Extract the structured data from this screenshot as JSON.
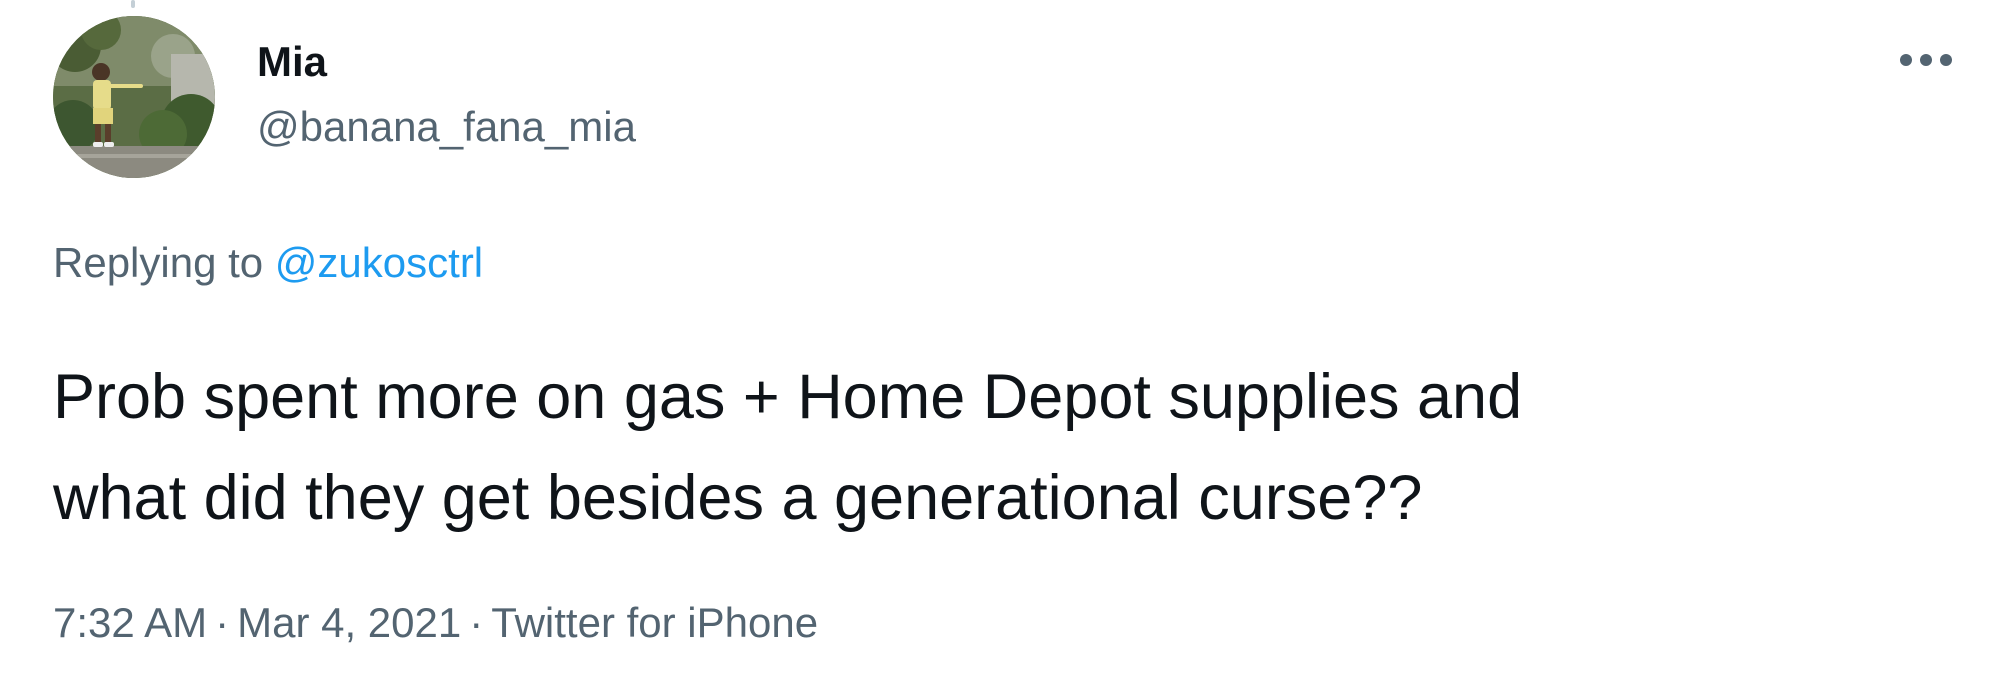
{
  "tweet": {
    "author": {
      "display_name": "Mia",
      "handle": "@banana_fana_mia"
    },
    "reply_context": {
      "prefix": "Replying to ",
      "mention": "@zukosctrl"
    },
    "text_lines": [
      "Prob spent more on gas + Home Depot supplies and",
      "what did they get besides a generational curse??"
    ],
    "meta": {
      "time": "7:32 AM",
      "separator": "·",
      "date": "Mar 4, 2021",
      "source": "Twitter for iPhone"
    },
    "icons": {
      "more": "more-options-icon",
      "avatar": "avatar-photo"
    },
    "colors": {
      "primary_text": "#0f1419",
      "secondary_text": "#536471",
      "link": "#1d9bf0",
      "background": "#ffffff"
    }
  }
}
